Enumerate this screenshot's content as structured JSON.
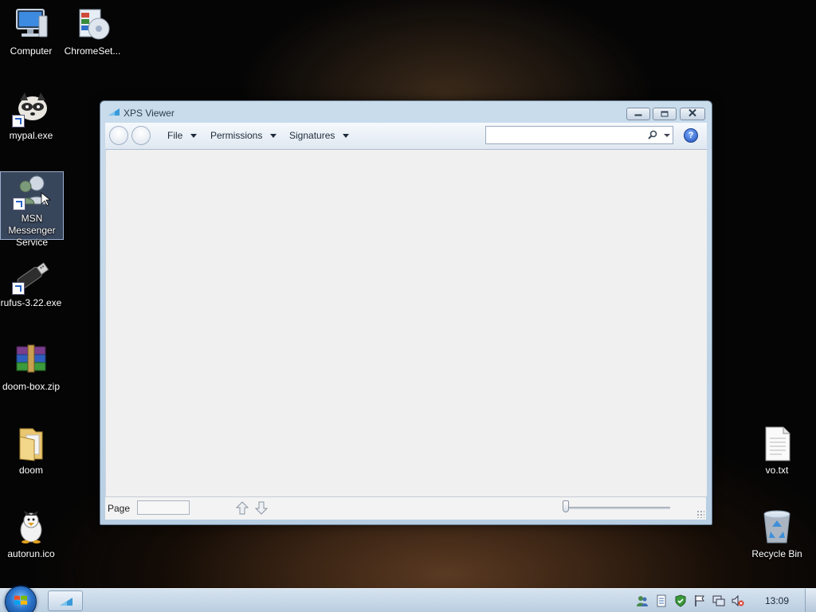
{
  "desktop": {
    "icons": [
      {
        "label": "Computer",
        "icon": "computer-icon"
      },
      {
        "label": "ChromeSet...",
        "icon": "chrome-setup-icon"
      },
      {
        "label": "mypal.exe",
        "icon": "raccoon-icon"
      },
      {
        "label": "MSN Messenger Service",
        "icon": "msn-messenger-icon"
      },
      {
        "label": "rufus-3.22.exe",
        "icon": "usb-drive-icon"
      },
      {
        "label": "doom-box.zip",
        "icon": "winrar-archive-icon"
      },
      {
        "label": "doom",
        "icon": "folder-icon"
      },
      {
        "label": "autorun.ico",
        "icon": "penguin-icon"
      },
      {
        "label": "vo.txt",
        "icon": "text-file-icon"
      },
      {
        "label": "Recycle Bin",
        "icon": "recycle-bin-icon"
      }
    ]
  },
  "window": {
    "title": "XPS Viewer",
    "menus": {
      "file": "File",
      "permissions": "Permissions",
      "signatures": "Signatures"
    },
    "search": {
      "value": "",
      "placeholder": ""
    },
    "help": "?",
    "status": {
      "page_label": "Page",
      "page_value": ""
    }
  },
  "taskbar": {
    "clock": "13:09"
  },
  "colors": {
    "window_frame": "#c9dcec",
    "content_bg": "#f0f0f0",
    "taskbar": "#c8d8e8",
    "accent": "#2a73c9"
  }
}
